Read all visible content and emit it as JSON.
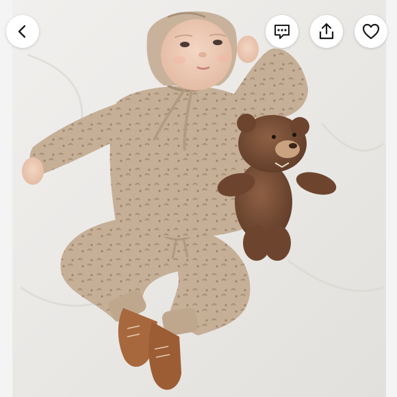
{
  "toolbar": {
    "back": {
      "icon": "chevron-left-icon"
    },
    "comments": {
      "icon": "comment-dots-icon"
    },
    "share": {
      "icon": "share-upload-icon"
    },
    "like": {
      "icon": "heart-outline-icon"
    }
  },
  "photo": {
    "subject": "baby-in-knit-outfit-with-teddy-bear"
  },
  "colors": {
    "button_bg": "#ffffff",
    "icon_stroke": "#1a1a1a",
    "knit": "#c9b29a",
    "blanket": "#ecebe8",
    "teddy": "#7a5036",
    "boots": "#a8683d"
  }
}
